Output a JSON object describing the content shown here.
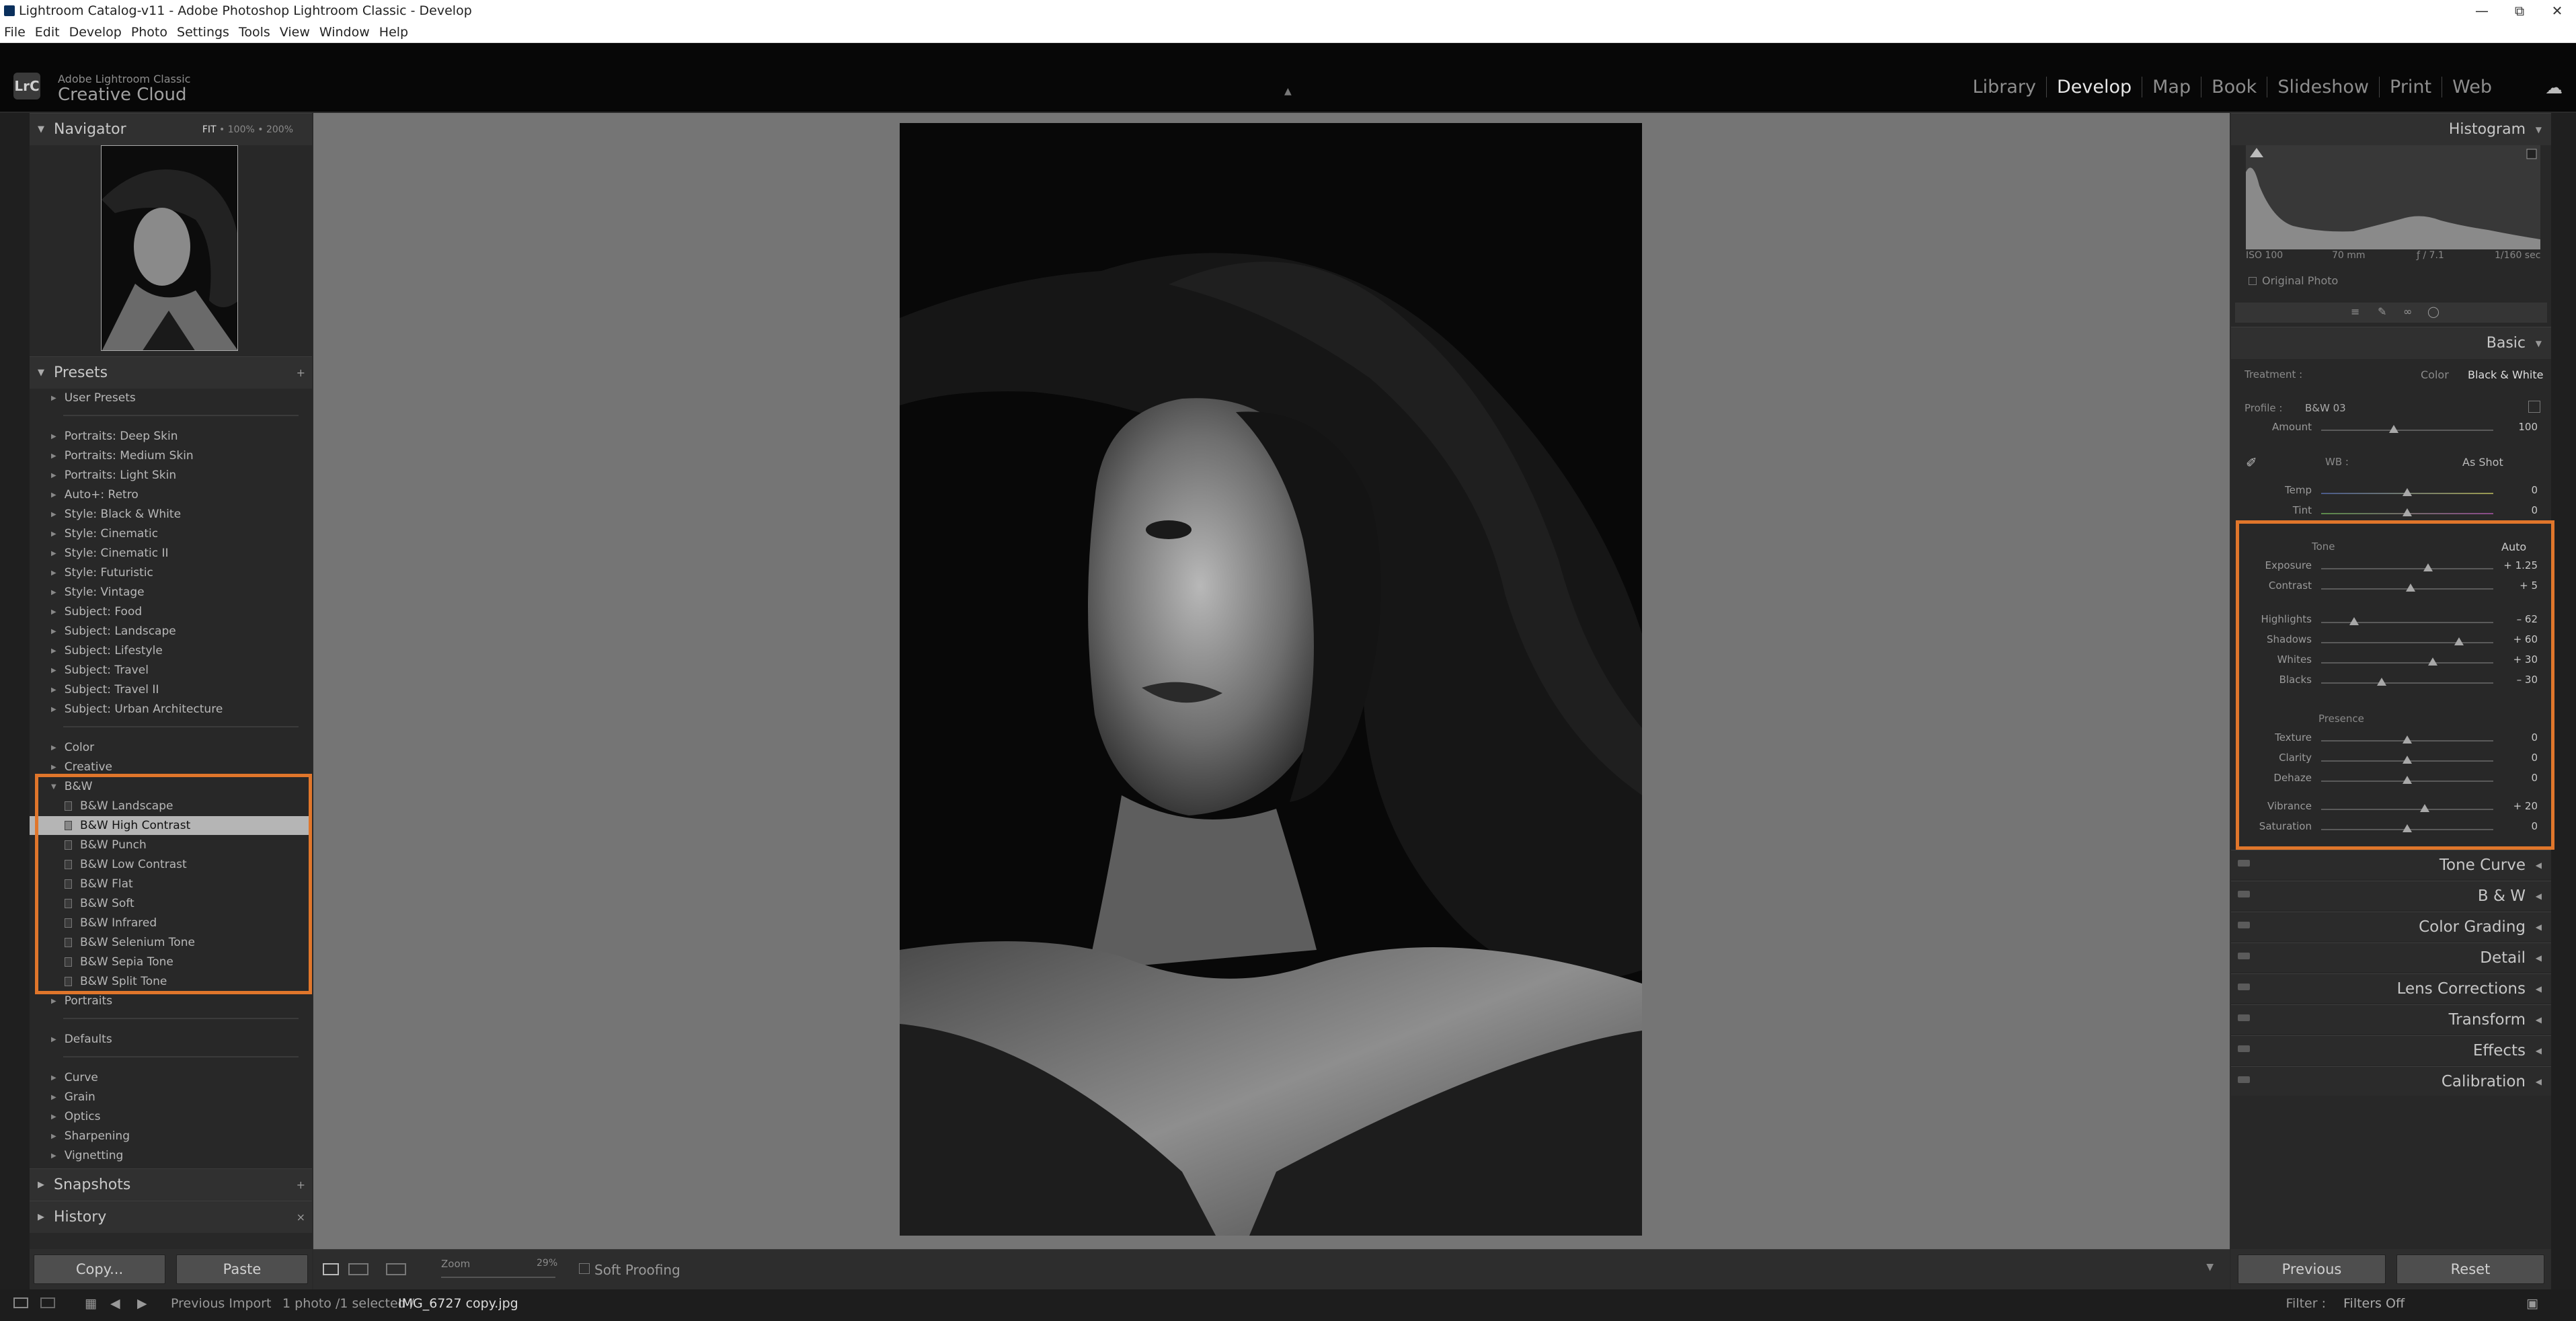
{
  "window": {
    "title": "Lightroom Catalog-v11 - Adobe Photoshop Lightroom Classic - Develop"
  },
  "menu": [
    "File",
    "Edit",
    "Develop",
    "Photo",
    "Settings",
    "Tools",
    "View",
    "Window",
    "Help"
  ],
  "identity": {
    "badge": "LrC",
    "line1": "Adobe Lightroom Classic",
    "line2": "Creative Cloud"
  },
  "modules": [
    "Library",
    "Develop",
    "Map",
    "Book",
    "Slideshow",
    "Print",
    "Web"
  ],
  "active_module": "Develop",
  "navigator": {
    "title": "Navigator",
    "fit": "FIT",
    "z1": "100%",
    "z2": "200%"
  },
  "presets": {
    "title": "Presets",
    "groups_top": [
      "User Presets"
    ],
    "groups_a": [
      "Portraits: Deep Skin",
      "Portraits: Medium Skin",
      "Portraits: Light Skin",
      "Auto+: Retro",
      "Style: Black & White",
      "Style: Cinematic",
      "Style: Cinematic II",
      "Style: Futuristic",
      "Style: Vintage",
      "Subject: Food",
      "Subject: Landscape",
      "Subject: Lifestyle",
      "Subject: Travel",
      "Subject: Travel II",
      "Subject: Urban Architecture"
    ],
    "groups_b": [
      "Color",
      "Creative",
      "B&W"
    ],
    "bw_items": [
      "B&W Landscape",
      "B&W High Contrast",
      "B&W Punch",
      "B&W Low Contrast",
      "B&W Flat",
      "B&W Soft",
      "B&W Infrared",
      "B&W Selenium Tone",
      "B&W Sepia Tone",
      "B&W Split Tone"
    ],
    "selected": "B&W High Contrast",
    "after_bw": [
      "Portraits"
    ],
    "defaults": [
      "Defaults"
    ],
    "groups_c": [
      "Curve",
      "Grain",
      "Optics",
      "Sharpening",
      "Vignetting"
    ]
  },
  "snapshots": "Snapshots",
  "history": "History",
  "buttons": {
    "copy": "Copy...",
    "paste": "Paste",
    "previous": "Previous",
    "reset": "Reset"
  },
  "toolbar": {
    "zoom": "Zoom",
    "zoom_value": "29%",
    "soft_proofing": "Soft Proofing"
  },
  "histogram": {
    "title": "Histogram",
    "iso": "ISO 100",
    "focal": "70 mm",
    "aperture": "ƒ / 7.1",
    "shutter": "1/160 sec",
    "original": "Original Photo"
  },
  "basic": {
    "title": "Basic",
    "treatment_label": "Treatment :",
    "color": "Color",
    "bw": "Black & White",
    "profile_label": "Profile :",
    "profile": "B&W 03",
    "amount_label": "Amount",
    "amount": "100",
    "wb_label": "WB :",
    "wb": "As Shot",
    "temp": {
      "label": "Temp",
      "value": "0",
      "pos": 0.5
    },
    "tint": {
      "label": "Tint",
      "value": "0",
      "pos": 0.5
    },
    "tone_label": "Tone",
    "auto": "Auto",
    "sliders": [
      {
        "label": "Exposure",
        "value": "+ 1.25",
        "pos": 0.62
      },
      {
        "label": "Contrast",
        "value": "+ 5",
        "pos": 0.52
      },
      {
        "label": "Highlights",
        "value": "– 62",
        "pos": 0.19
      },
      {
        "label": "Shadows",
        "value": "+ 60",
        "pos": 0.8
      },
      {
        "label": "Whites",
        "value": "+ 30",
        "pos": 0.65
      },
      {
        "label": "Blacks",
        "value": "– 30",
        "pos": 0.35
      }
    ],
    "presence_label": "Presence",
    "presence": [
      {
        "label": "Texture",
        "value": "0",
        "pos": 0.5
      },
      {
        "label": "Clarity",
        "value": "0",
        "pos": 0.5
      },
      {
        "label": "Dehaze",
        "value": "0",
        "pos": 0.5
      },
      {
        "label": "Vibrance",
        "value": "+ 20",
        "pos": 0.6
      },
      {
        "label": "Saturation",
        "value": "0",
        "pos": 0.5
      }
    ]
  },
  "sections": [
    "Tone Curve",
    "B & W",
    "Color Grading",
    "Detail",
    "Lens Corrections",
    "Transform",
    "Effects",
    "Calibration"
  ],
  "filmstrip": {
    "source": "Previous Import",
    "count": "1 photo /1 selected /",
    "file": "IMG_6727 copy.jpg",
    "filter_label": "Filter :",
    "filter": "Filters Off"
  }
}
